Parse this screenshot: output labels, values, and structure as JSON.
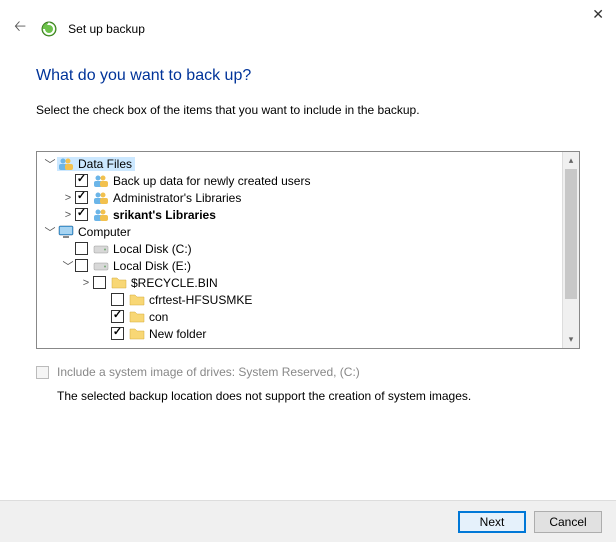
{
  "window": {
    "title": "Set up backup",
    "question": "What do you want to back up?",
    "instruction": "Select the check box of the items that you want to include in the backup."
  },
  "tree": {
    "nodes": [
      {
        "id": "data-files",
        "indent": 0,
        "exp": "open",
        "cb": null,
        "icon": "people",
        "label": "Data Files",
        "bold": false,
        "hl": true
      },
      {
        "id": "new-users",
        "indent": 1,
        "exp": "none",
        "cb": "checked",
        "icon": "people",
        "label": "Back up data for newly created users",
        "bold": false,
        "hl": false
      },
      {
        "id": "admin-lib",
        "indent": 1,
        "exp": "closed",
        "cb": "checked",
        "icon": "people",
        "label": "Administrator's Libraries",
        "bold": false,
        "hl": false
      },
      {
        "id": "srikant-lib",
        "indent": 1,
        "exp": "closed",
        "cb": "checked",
        "icon": "people",
        "label": "srikant's Libraries",
        "bold": true,
        "hl": false
      },
      {
        "id": "computer",
        "indent": 0,
        "exp": "open",
        "cb": null,
        "icon": "computer",
        "label": "Computer",
        "bold": false,
        "hl": false
      },
      {
        "id": "disk-c",
        "indent": 1,
        "exp": "none",
        "cb": "unchecked",
        "icon": "drive",
        "label": "Local Disk (C:)",
        "bold": false,
        "hl": false
      },
      {
        "id": "disk-e",
        "indent": 1,
        "exp": "open",
        "cb": "unchecked",
        "icon": "drive",
        "label": "Local Disk (E:)",
        "bold": false,
        "hl": false
      },
      {
        "id": "recycle",
        "indent": 2,
        "exp": "closed",
        "cb": "unchecked",
        "icon": "folder",
        "label": "$RECYCLE.BIN",
        "bold": false,
        "hl": false
      },
      {
        "id": "cfrtest",
        "indent": 3,
        "exp": "none",
        "cb": "unchecked",
        "icon": "folder",
        "label": "cfrtest-HFSUSMKE",
        "bold": false,
        "hl": false
      },
      {
        "id": "con",
        "indent": 3,
        "exp": "none",
        "cb": "checked",
        "icon": "folder",
        "label": "con",
        "bold": false,
        "hl": false
      },
      {
        "id": "newfolder",
        "indent": 3,
        "exp": "none",
        "cb": "checked",
        "icon": "folder",
        "label": "New folder",
        "bold": false,
        "hl": false
      }
    ]
  },
  "systemImage": {
    "label": "Include a system image of drives: System Reserved, (C:)",
    "message": "The selected backup location does not support the creation of system images."
  },
  "buttons": {
    "next": "Next",
    "cancel": "Cancel"
  }
}
